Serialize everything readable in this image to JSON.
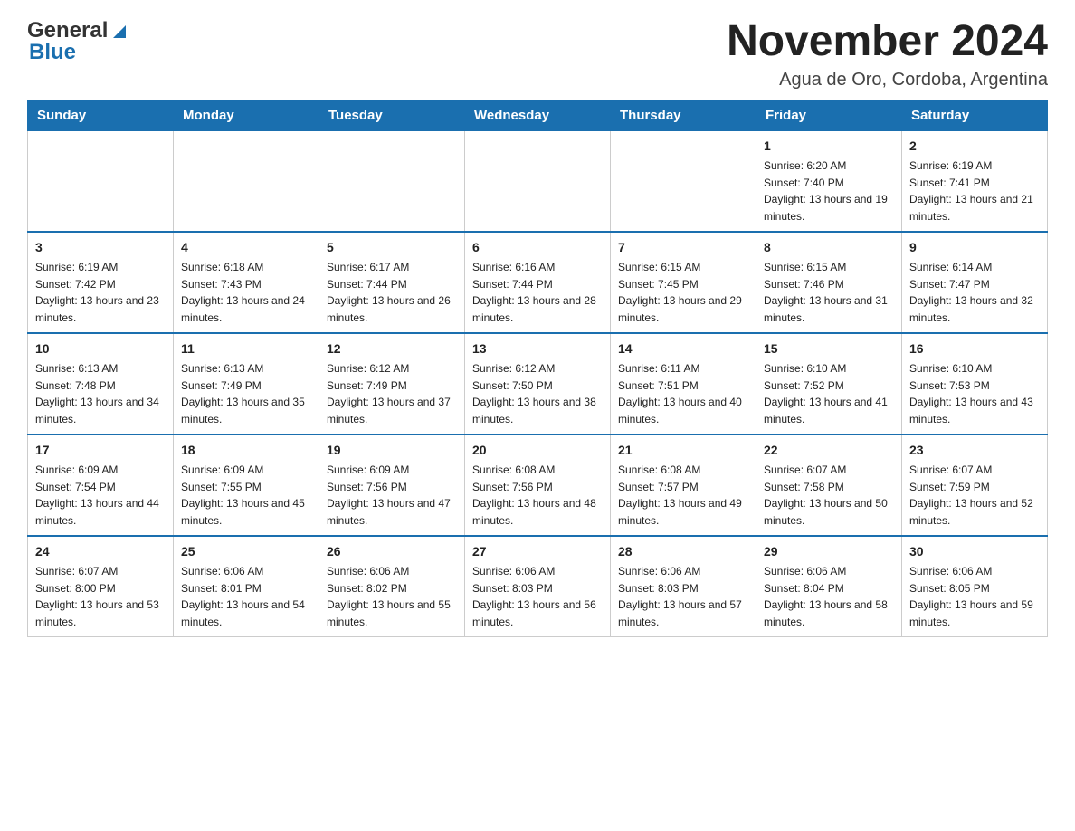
{
  "header": {
    "logo_general": "General",
    "logo_blue": "Blue",
    "month_title": "November 2024",
    "location": "Agua de Oro, Cordoba, Argentina"
  },
  "days_of_week": [
    "Sunday",
    "Monday",
    "Tuesday",
    "Wednesday",
    "Thursday",
    "Friday",
    "Saturday"
  ],
  "weeks": [
    [
      {
        "day": "",
        "info": ""
      },
      {
        "day": "",
        "info": ""
      },
      {
        "day": "",
        "info": ""
      },
      {
        "day": "",
        "info": ""
      },
      {
        "day": "",
        "info": ""
      },
      {
        "day": "1",
        "info": "Sunrise: 6:20 AM\nSunset: 7:40 PM\nDaylight: 13 hours and 19 minutes."
      },
      {
        "day": "2",
        "info": "Sunrise: 6:19 AM\nSunset: 7:41 PM\nDaylight: 13 hours and 21 minutes."
      }
    ],
    [
      {
        "day": "3",
        "info": "Sunrise: 6:19 AM\nSunset: 7:42 PM\nDaylight: 13 hours and 23 minutes."
      },
      {
        "day": "4",
        "info": "Sunrise: 6:18 AM\nSunset: 7:43 PM\nDaylight: 13 hours and 24 minutes."
      },
      {
        "day": "5",
        "info": "Sunrise: 6:17 AM\nSunset: 7:44 PM\nDaylight: 13 hours and 26 minutes."
      },
      {
        "day": "6",
        "info": "Sunrise: 6:16 AM\nSunset: 7:44 PM\nDaylight: 13 hours and 28 minutes."
      },
      {
        "day": "7",
        "info": "Sunrise: 6:15 AM\nSunset: 7:45 PM\nDaylight: 13 hours and 29 minutes."
      },
      {
        "day": "8",
        "info": "Sunrise: 6:15 AM\nSunset: 7:46 PM\nDaylight: 13 hours and 31 minutes."
      },
      {
        "day": "9",
        "info": "Sunrise: 6:14 AM\nSunset: 7:47 PM\nDaylight: 13 hours and 32 minutes."
      }
    ],
    [
      {
        "day": "10",
        "info": "Sunrise: 6:13 AM\nSunset: 7:48 PM\nDaylight: 13 hours and 34 minutes."
      },
      {
        "day": "11",
        "info": "Sunrise: 6:13 AM\nSunset: 7:49 PM\nDaylight: 13 hours and 35 minutes."
      },
      {
        "day": "12",
        "info": "Sunrise: 6:12 AM\nSunset: 7:49 PM\nDaylight: 13 hours and 37 minutes."
      },
      {
        "day": "13",
        "info": "Sunrise: 6:12 AM\nSunset: 7:50 PM\nDaylight: 13 hours and 38 minutes."
      },
      {
        "day": "14",
        "info": "Sunrise: 6:11 AM\nSunset: 7:51 PM\nDaylight: 13 hours and 40 minutes."
      },
      {
        "day": "15",
        "info": "Sunrise: 6:10 AM\nSunset: 7:52 PM\nDaylight: 13 hours and 41 minutes."
      },
      {
        "day": "16",
        "info": "Sunrise: 6:10 AM\nSunset: 7:53 PM\nDaylight: 13 hours and 43 minutes."
      }
    ],
    [
      {
        "day": "17",
        "info": "Sunrise: 6:09 AM\nSunset: 7:54 PM\nDaylight: 13 hours and 44 minutes."
      },
      {
        "day": "18",
        "info": "Sunrise: 6:09 AM\nSunset: 7:55 PM\nDaylight: 13 hours and 45 minutes."
      },
      {
        "day": "19",
        "info": "Sunrise: 6:09 AM\nSunset: 7:56 PM\nDaylight: 13 hours and 47 minutes."
      },
      {
        "day": "20",
        "info": "Sunrise: 6:08 AM\nSunset: 7:56 PM\nDaylight: 13 hours and 48 minutes."
      },
      {
        "day": "21",
        "info": "Sunrise: 6:08 AM\nSunset: 7:57 PM\nDaylight: 13 hours and 49 minutes."
      },
      {
        "day": "22",
        "info": "Sunrise: 6:07 AM\nSunset: 7:58 PM\nDaylight: 13 hours and 50 minutes."
      },
      {
        "day": "23",
        "info": "Sunrise: 6:07 AM\nSunset: 7:59 PM\nDaylight: 13 hours and 52 minutes."
      }
    ],
    [
      {
        "day": "24",
        "info": "Sunrise: 6:07 AM\nSunset: 8:00 PM\nDaylight: 13 hours and 53 minutes."
      },
      {
        "day": "25",
        "info": "Sunrise: 6:06 AM\nSunset: 8:01 PM\nDaylight: 13 hours and 54 minutes."
      },
      {
        "day": "26",
        "info": "Sunrise: 6:06 AM\nSunset: 8:02 PM\nDaylight: 13 hours and 55 minutes."
      },
      {
        "day": "27",
        "info": "Sunrise: 6:06 AM\nSunset: 8:03 PM\nDaylight: 13 hours and 56 minutes."
      },
      {
        "day": "28",
        "info": "Sunrise: 6:06 AM\nSunset: 8:03 PM\nDaylight: 13 hours and 57 minutes."
      },
      {
        "day": "29",
        "info": "Sunrise: 6:06 AM\nSunset: 8:04 PM\nDaylight: 13 hours and 58 minutes."
      },
      {
        "day": "30",
        "info": "Sunrise: 6:06 AM\nSunset: 8:05 PM\nDaylight: 13 hours and 59 minutes."
      }
    ]
  ]
}
